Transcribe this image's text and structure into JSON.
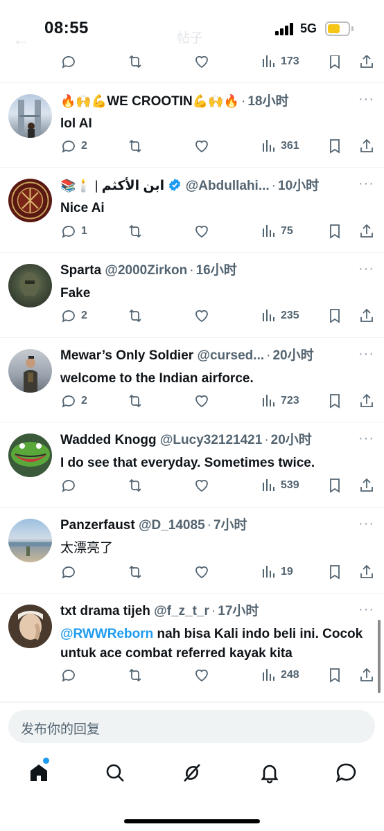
{
  "status_bar": {
    "time": "08:55",
    "network": "5G",
    "faded_title": "帖子",
    "faded_back": "←"
  },
  "tweets": [
    {
      "name": "",
      "handle": "",
      "time": "",
      "text": "",
      "reply_count": "",
      "view_count": "173"
    },
    {
      "name_emoji_left": "🔥🙌💪",
      "name": "WE CROOTIN",
      "name_emoji_right": "💪🙌🔥",
      "handle": "",
      "time": "18小时",
      "text": "lol AI",
      "reply_count": "2",
      "view_count": "361"
    },
    {
      "name_emoji_left": "📚🕯️ |",
      "name": "ابن الأكثم",
      "handle": "@Abdullahi...",
      "time": "10小时",
      "text": "Nice Ai",
      "reply_count": "1",
      "view_count": "75"
    },
    {
      "name": "Sparta",
      "handle": "@2000Zirkon",
      "time": "16小时",
      "text": "Fake",
      "reply_count": "2",
      "view_count": "235"
    },
    {
      "name": "Mewar’s Only Soldier",
      "handle": "@cursed...",
      "time": "20小时",
      "text": "welcome to the Indian airforce.",
      "reply_count": "2",
      "view_count": "723"
    },
    {
      "name": "Wadded Knogg",
      "handle": "@Lucy32121421",
      "time": "20小时",
      "text": "I do see that everyday. Sometimes twice.",
      "reply_count": "",
      "view_count": "539"
    },
    {
      "name": "Panzerfaust",
      "handle": "@D_14085",
      "time": "7小时",
      "text": "太漂亮了",
      "reply_count": "",
      "view_count": "19"
    },
    {
      "name": "txt drama tijeh",
      "handle": "@f_z_t_r",
      "time": "17小时",
      "mention": "@RWWReborn",
      "text": " nah bisa Kali indo beli ini. Cocok untuk ace combat referred kayak kita",
      "reply_count": "",
      "view_count": "248"
    }
  ],
  "reply_box": {
    "placeholder": "发布你的回复"
  },
  "tabs": [
    "home-icon",
    "search-icon",
    "grok-icon",
    "notifications-icon",
    "messages-icon"
  ],
  "colors": {
    "accent": "#1d9bf0",
    "muted": "#536471",
    "text": "#0f1419"
  }
}
